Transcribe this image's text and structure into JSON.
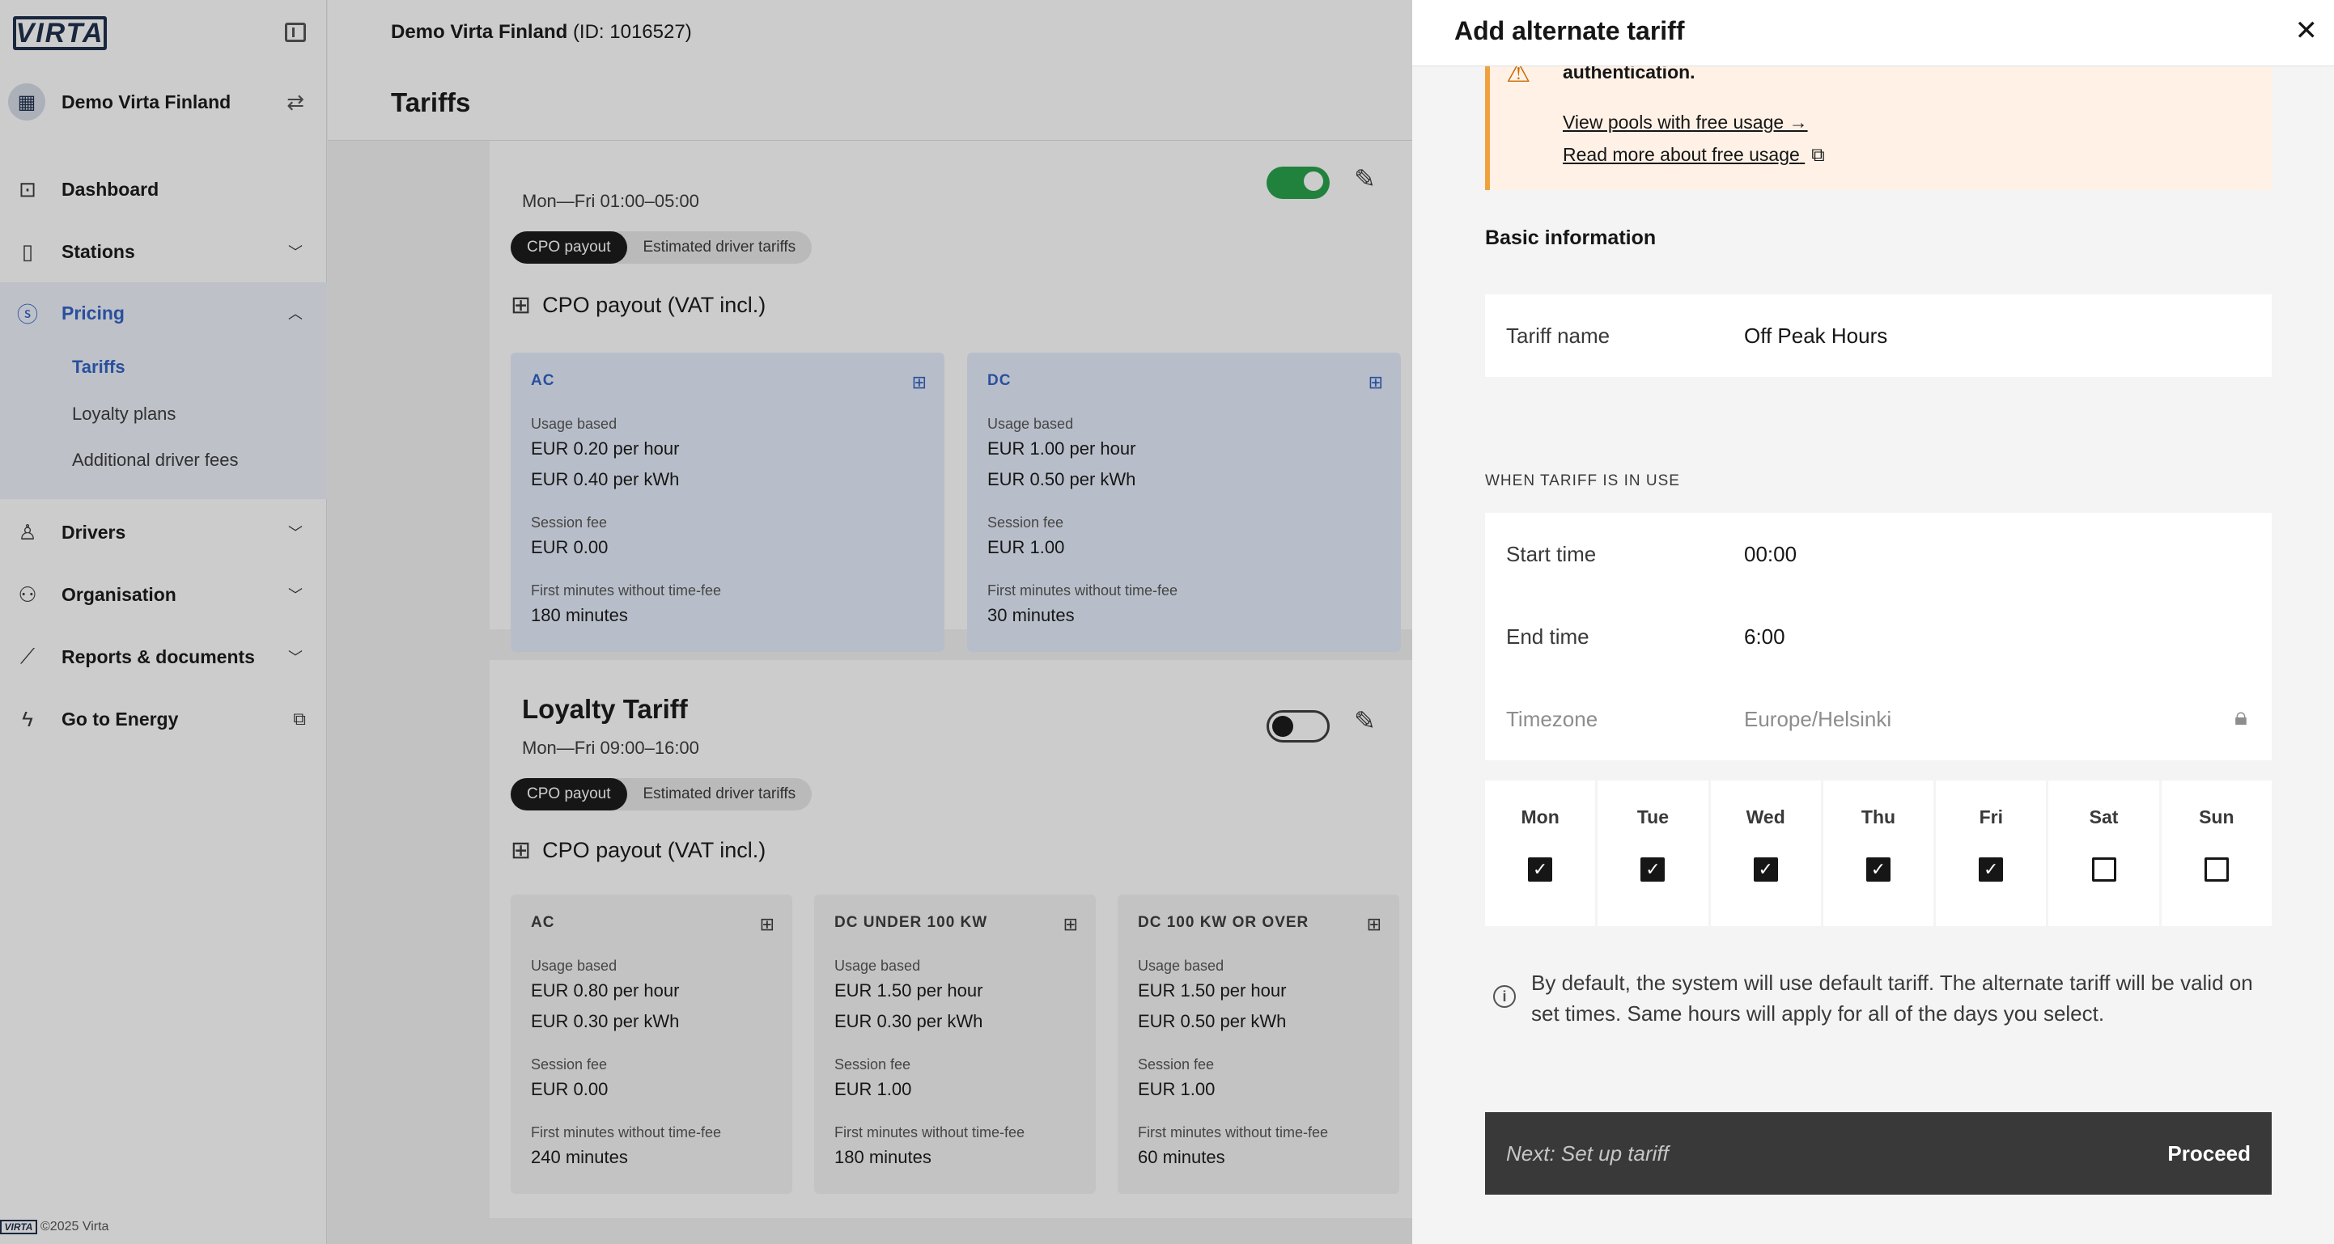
{
  "app": {
    "logo_text": "VIRTA",
    "org_name": "Demo Virta Finland",
    "footer": "©2025 Virta"
  },
  "nav": {
    "dashboard": "Dashboard",
    "stations": "Stations",
    "pricing": "Pricing",
    "pricing_sub": [
      "Tariffs",
      "Loyalty plans",
      "Additional driver fees"
    ],
    "drivers": "Drivers",
    "organisation": "Organisation",
    "reports": "Reports & documents",
    "energy": "Go to Energy"
  },
  "header": {
    "org": "Demo Virta Finland",
    "org_id": "(ID: 1016527)",
    "page_title": "Tariffs"
  },
  "tariffs": [
    {
      "days": "Mon—Fri 01:00–05:00",
      "enabled": true,
      "tabs": [
        "CPO payout",
        "Estimated driver tariffs"
      ],
      "section": "CPO payout (VAT incl.)",
      "boxes": [
        {
          "title": "AC",
          "usage_label": "Usage based",
          "per_hour": "EUR 0.20 per hour",
          "per_kwh": "EUR 0.40 per kWh",
          "session_label": "Session fee",
          "session": "EUR 0.00",
          "minutes_label": "First minutes without time-fee",
          "minutes": "180 minutes"
        },
        {
          "title": "DC",
          "usage_label": "Usage based",
          "per_hour": "EUR 1.00 per hour",
          "per_kwh": "EUR 0.50 per kWh",
          "session_label": "Session fee",
          "session": "EUR 1.00",
          "minutes_label": "First minutes without time-fee",
          "minutes": "30 minutes"
        }
      ]
    },
    {
      "name": "Loyalty Tariff",
      "days": "Mon—Fri 09:00–16:00",
      "enabled": false,
      "tabs": [
        "CPO payout",
        "Estimated driver tariffs"
      ],
      "section": "CPO payout (VAT incl.)",
      "boxes": [
        {
          "title": "AC",
          "usage_label": "Usage based",
          "per_hour": "EUR 0.80 per hour",
          "per_kwh": "EUR 0.30 per kWh",
          "session_label": "Session fee",
          "session": "EUR 0.00",
          "minutes_label": "First minutes without time-fee",
          "minutes": "240 minutes"
        },
        {
          "title": "DC UNDER 100 KW",
          "usage_label": "Usage based",
          "per_hour": "EUR 1.50 per hour",
          "per_kwh": "EUR 0.30 per kWh",
          "session_label": "Session fee",
          "session": "EUR 1.00",
          "minutes_label": "First minutes without time-fee",
          "minutes": "180 minutes"
        },
        {
          "title": "DC 100 KW OR OVER",
          "usage_label": "Usage based",
          "per_hour": "EUR 1.50 per hour",
          "per_kwh": "EUR 0.50 per kWh",
          "session_label": "Session fee",
          "session": "EUR 1.00",
          "minutes_label": "First minutes without time-fee",
          "minutes": "60 minutes"
        }
      ]
    }
  ],
  "panel": {
    "title": "Add alternate tariff",
    "warning_text": "authentication.",
    "link_pools": "View pools with free usage →",
    "link_read": "Read more about free usage",
    "basic_info": "Basic information",
    "tariff_name_label": "Tariff name",
    "tariff_name_value": "Off Peak Hours",
    "when_caption": "WHEN TARIFF IS IN USE",
    "start_label": "Start time",
    "start_value": "00:00",
    "end_label": "End time",
    "end_value": "6:00",
    "tz_label": "Timezone",
    "tz_value": "Europe/Helsinki",
    "days": [
      {
        "name": "Mon",
        "checked": true
      },
      {
        "name": "Tue",
        "checked": true
      },
      {
        "name": "Wed",
        "checked": true
      },
      {
        "name": "Thu",
        "checked": true
      },
      {
        "name": "Fri",
        "checked": true
      },
      {
        "name": "Sat",
        "checked": false
      },
      {
        "name": "Sun",
        "checked": false
      }
    ],
    "info": "By default, the system will use default tariff. The alternate tariff will be valid on set times. Same hours will apply for all of the days you select.",
    "next_label": "Next: Set up tariff",
    "proceed": "Proceed"
  },
  "colors": {
    "accent": "#2f5fc4",
    "toggle_on": "#24a148",
    "warning_bg": "#fff1e6",
    "warning_border": "#f1a13b",
    "next_bar": "#393939"
  }
}
